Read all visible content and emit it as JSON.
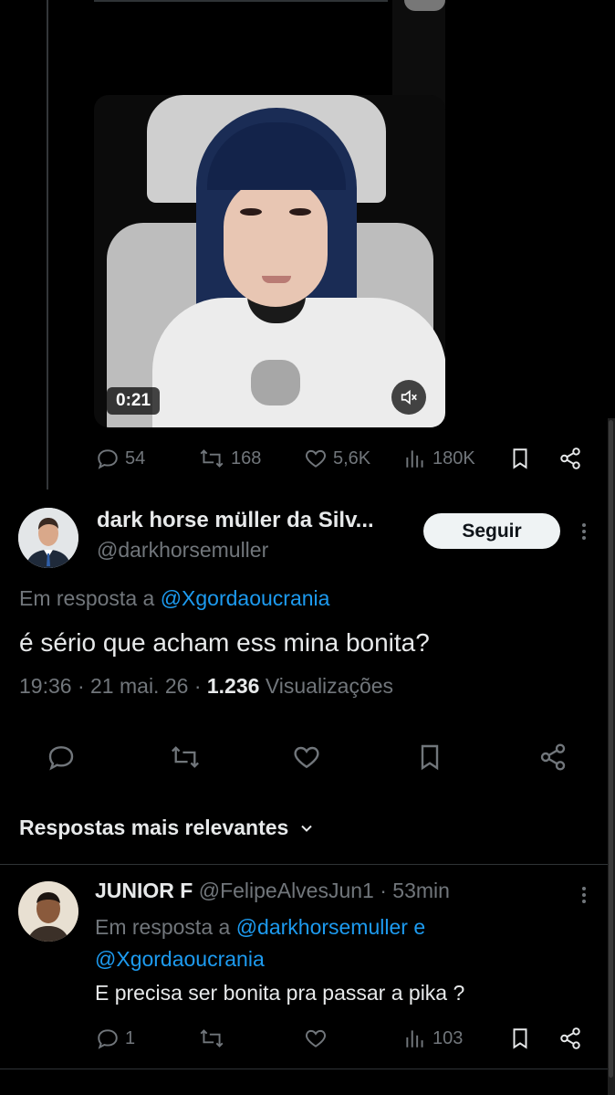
{
  "video": {
    "time": "0:21",
    "mute_icon": "volume-muted-icon"
  },
  "quoted_actions": {
    "replies": "54",
    "reposts": "168",
    "likes": "5,6K",
    "views": "180K"
  },
  "tweet": {
    "author_name": "dark horse müller da Silv...",
    "author_handle": "@darkhorsemuller",
    "follow_label": "Seguir",
    "reply_prefix": "Em resposta a",
    "reply_mention": "@Xgordaoucrania",
    "text": "é sério que acham ess mina bonita?",
    "time": "19:36",
    "date": "21 mai. 26",
    "separator": "·",
    "views_count": "1.236",
    "views_label": "Visualizações"
  },
  "replies_section": {
    "title": "Respostas mais relevantes"
  },
  "reply": {
    "author_name": "JUNIOR F",
    "author_handle": "@FelipeAlvesJun1",
    "separator": "·",
    "age": "53min",
    "reply_prefix": "Em resposta a",
    "mention1": "@darkhorsemuller",
    "conj": "e",
    "mention2": "@Xgordaoucrania",
    "text": "E precisa ser bonita pra passar a pika ?",
    "replies": "1",
    "views": "103"
  },
  "colors": {
    "background": "#000000",
    "text": "#e7e9ea",
    "muted": "#71767b",
    "link": "#1d9bf0"
  }
}
